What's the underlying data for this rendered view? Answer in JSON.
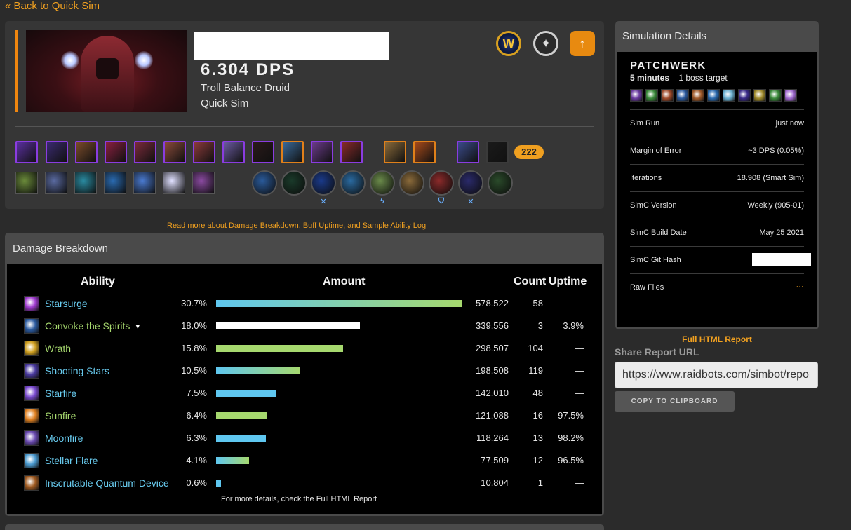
{
  "nav": {
    "back_label": "« Back to Quick Sim"
  },
  "character": {
    "dps": "6.304 DPS",
    "race_spec": "Troll Balance Druid",
    "sim_type": "Quick Sim",
    "item_level": "222",
    "brand_icons": [
      "warcraft-logo-icon",
      "warcraftlogs-icon",
      "raidbots-icon"
    ]
  },
  "gear_colors": [
    "#5a2fa0",
    "#3a2a70",
    "#7a4a2a",
    "#8a2040",
    "#7a2a3a",
    "#8a4a3a",
    "#8a3a3a",
    "#6a5aa0",
    "#2a1a1a",
    "#3a6a9a",
    "#6a3a8a",
    "#8a2a2a",
    "#8a6a3a",
    "#a84a1a",
    "#3a4a8a",
    "#1a1a1a"
  ],
  "talent_colors": [
    "#6a8a3a",
    "#5a6aa0",
    "#2a8aa0",
    "#2a6ab0",
    "#4a7ad0",
    "#e0e0ff",
    "#8a4aa0"
  ],
  "conduit_colors": [
    "#2a5a9a",
    "#1a3a2a",
    "#1a3a8a",
    "#2a6aa0",
    "#6a8a4a",
    "#8a6a3a",
    "#8a2a2a",
    "#2a2a6a",
    "#2a4a2a"
  ],
  "conduit_marks": [
    "✕",
    "ϟ",
    "⛉",
    "✕"
  ],
  "read_more": "Read more about Damage Breakdown, Buff Uptime, and Sample Ability Log",
  "damage": {
    "title": "Damage Breakdown",
    "headers": {
      "ability": "Ability",
      "amount": "Amount",
      "count": "Count",
      "uptime": "Uptime"
    },
    "rows": [
      {
        "name": "Starsurge",
        "pct": "30.7%",
        "amount": "578.522",
        "count": "58",
        "uptime": "—",
        "fill": 1.0,
        "bar": "linear-gradient(90deg,#5fc7f0,#a6d86e)",
        "icon": "#a03ad0",
        "name_color": "blue",
        "caret": ""
      },
      {
        "name": "Convoke the Spirits",
        "pct": "18.0%",
        "amount": "339.556",
        "count": "3",
        "uptime": "3.9%",
        "fill": 0.587,
        "bar": "#ffffff",
        "icon": "#2a5aa0",
        "name_color": "green",
        "caret": "▼"
      },
      {
        "name": "Wrath",
        "pct": "15.8%",
        "amount": "298.507",
        "count": "104",
        "uptime": "—",
        "fill": 0.516,
        "bar": "#a6d86e",
        "icon": "#d0a020",
        "name_color": "green",
        "caret": ""
      },
      {
        "name": "Shooting Stars",
        "pct": "10.5%",
        "amount": "198.508",
        "count": "119",
        "uptime": "—",
        "fill": 0.343,
        "bar": "linear-gradient(90deg,#5fc7f0,#a6d86e)",
        "icon": "#4a3aa0",
        "name_color": "blue",
        "caret": ""
      },
      {
        "name": "Starfire",
        "pct": "7.5%",
        "amount": "142.010",
        "count": "48",
        "uptime": "—",
        "fill": 0.245,
        "bar": "#5fc7f0",
        "icon": "#7a4ad0",
        "name_color": "blue",
        "caret": ""
      },
      {
        "name": "Sunfire",
        "pct": "6.4%",
        "amount": "121.088",
        "count": "16",
        "uptime": "97.5%",
        "fill": 0.209,
        "bar": "#a6d86e",
        "icon": "#e08020",
        "name_color": "green",
        "caret": ""
      },
      {
        "name": "Moonfire",
        "pct": "6.3%",
        "amount": "118.264",
        "count": "13",
        "uptime": "98.2%",
        "fill": 0.204,
        "bar": "#5fc7f0",
        "icon": "#6a4ab0",
        "name_color": "blue",
        "caret": ""
      },
      {
        "name": "Stellar Flare",
        "pct": "4.1%",
        "amount": "77.509",
        "count": "12",
        "uptime": "96.5%",
        "fill": 0.134,
        "bar": "linear-gradient(90deg,#5fc7f0,#a6d86e)",
        "icon": "#4a9ad0",
        "name_color": "blue",
        "caret": ""
      },
      {
        "name": "Inscrutable Quantum Device",
        "pct": "0.6%",
        "amount": "10.804",
        "count": "1",
        "uptime": "—",
        "fill": 0.019,
        "bar": "#5fc7f0",
        "icon": "#a05a20",
        "name_color": "blue",
        "caret": ""
      }
    ],
    "footnote": "For more details, check the Full HTML Report"
  },
  "sim": {
    "title": "Simulation Details",
    "fight_style": "PATCHWERK",
    "duration": "5 minutes",
    "targets": "1 boss target",
    "buff_colors": [
      "#6a3aa0",
      "#3a8a3a",
      "#a04a2a",
      "#2a5aa0",
      "#a05a2a",
      "#2a6ab0",
      "#6ab0d0",
      "#3a2a8a",
      "#a08a2a",
      "#3a8a3a",
      "#a06ad0"
    ],
    "details": [
      {
        "key": "Sim Run",
        "value": "just now"
      },
      {
        "key": "Margin of Error",
        "value": "~3 DPS (0.05%)"
      },
      {
        "key": "Iterations",
        "value": "18.908 (Smart Sim)"
      },
      {
        "key": "SimC Version",
        "value": "Weekly (905-01)"
      },
      {
        "key": "SimC Build Date",
        "value": "May 25 2021"
      },
      {
        "key": "SimC Git Hash",
        "value": ""
      },
      {
        "key": "Raw Files",
        "value": "···"
      }
    ],
    "full_report": "Full HTML Report"
  },
  "share": {
    "label": "Share Report URL",
    "url": "https://www.raidbots.com/simbot/report",
    "copy_label": "COPY TO CLIPBOARD"
  }
}
